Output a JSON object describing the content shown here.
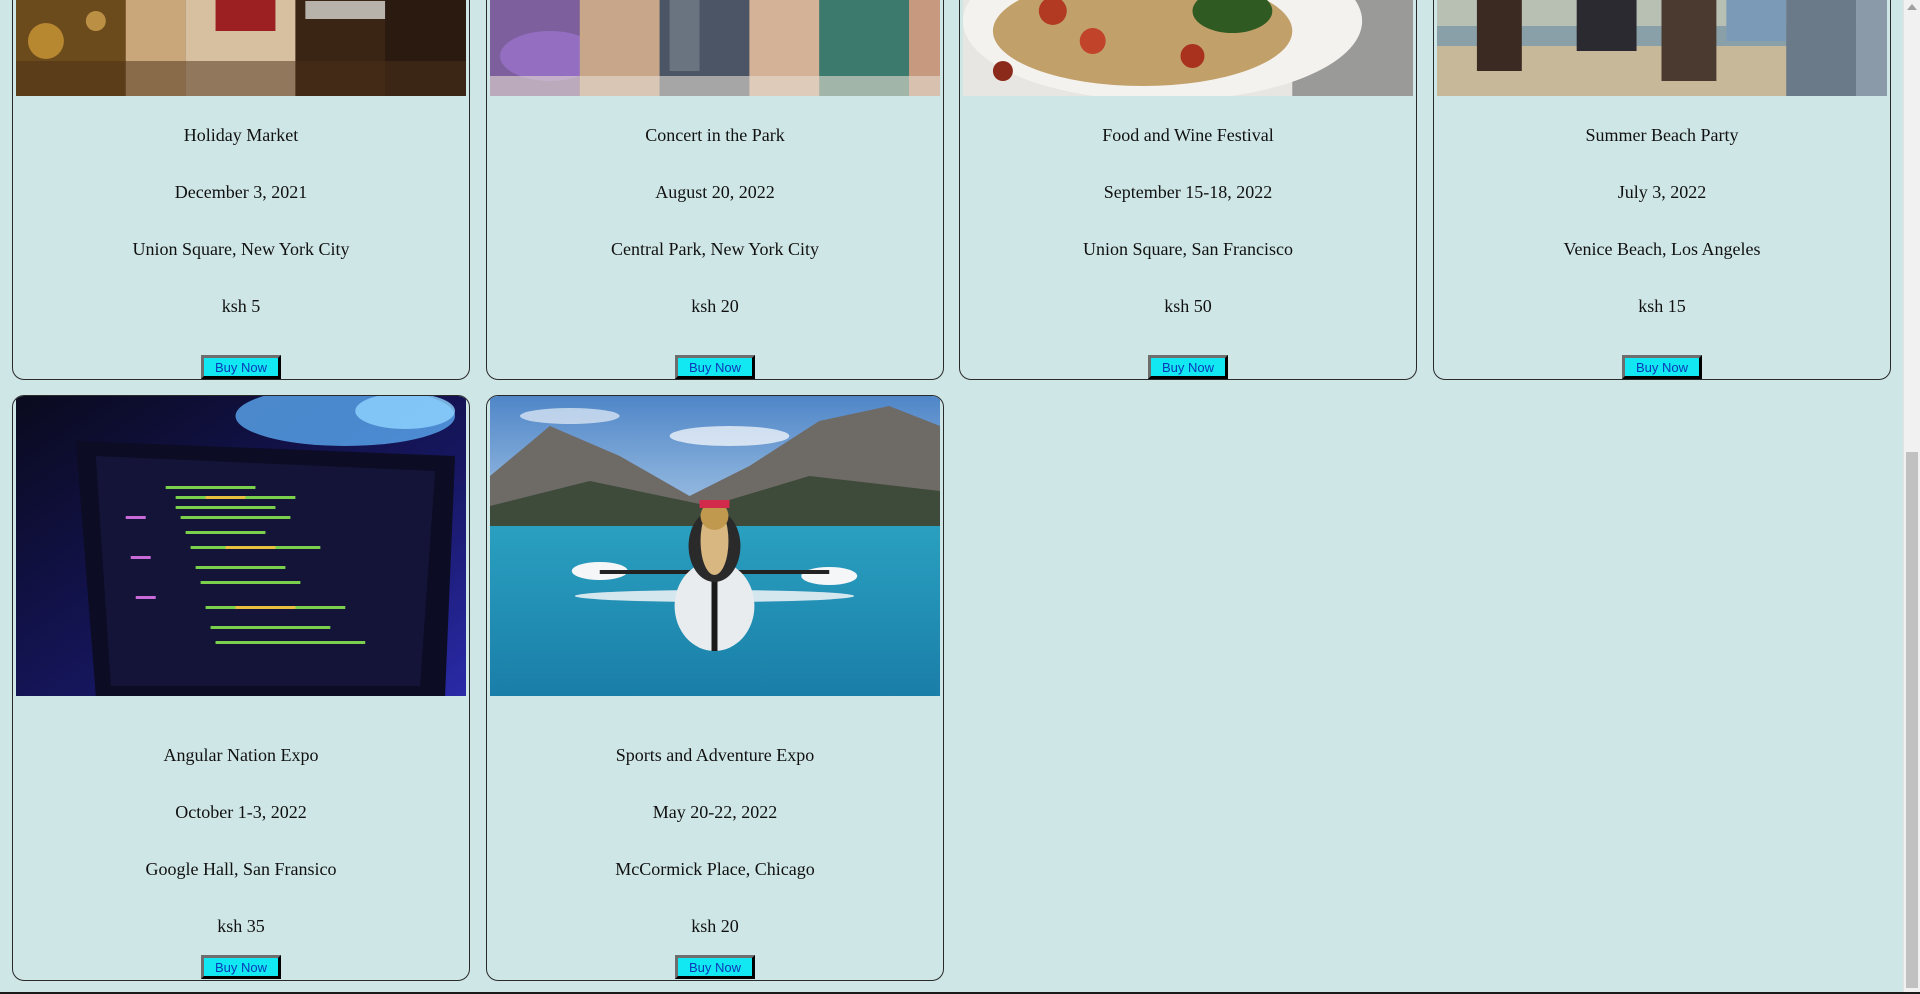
{
  "events": [
    {
      "title": "Holiday Market",
      "date": "December 3, 2021",
      "venue": "Union Square, New York City",
      "price": "ksh 5",
      "button": "Buy Now",
      "image": "holiday-market-photo"
    },
    {
      "title": "Concert in the Park",
      "date": "August 20, 2022",
      "venue": "Central Park, New York City",
      "price": "ksh 20",
      "button": "Buy Now",
      "image": "concert-crowd-photo"
    },
    {
      "title": "Food and Wine Festival",
      "date": "September 15-18, 2022",
      "venue": "Union Square, San Francisco",
      "price": "ksh 50",
      "button": "Buy Now",
      "image": "pasta-dish-photo"
    },
    {
      "title": "Summer Beach Party",
      "date": "July 3, 2022",
      "venue": "Venice Beach, Los Angeles",
      "price": "ksh 15",
      "button": "Buy Now",
      "image": "beach-friends-photo"
    },
    {
      "title": "Angular Nation Expo",
      "date": "October 1-3, 2022",
      "venue": "Google Hall, San Fransico",
      "price": "ksh 35",
      "button": "Buy Now",
      "image": "laptop-code-photo"
    },
    {
      "title": "Sports and Adventure Expo",
      "date": "May 20-22, 2022",
      "venue": "McCormick Place, Chicago",
      "price": "ksh 20",
      "button": "Buy Now",
      "image": "kayak-lake-photo"
    }
  ],
  "colors": {
    "page_background": "#cfe6e6",
    "button_background": "#12e8f2",
    "button_text": "#0a3ab8"
  }
}
